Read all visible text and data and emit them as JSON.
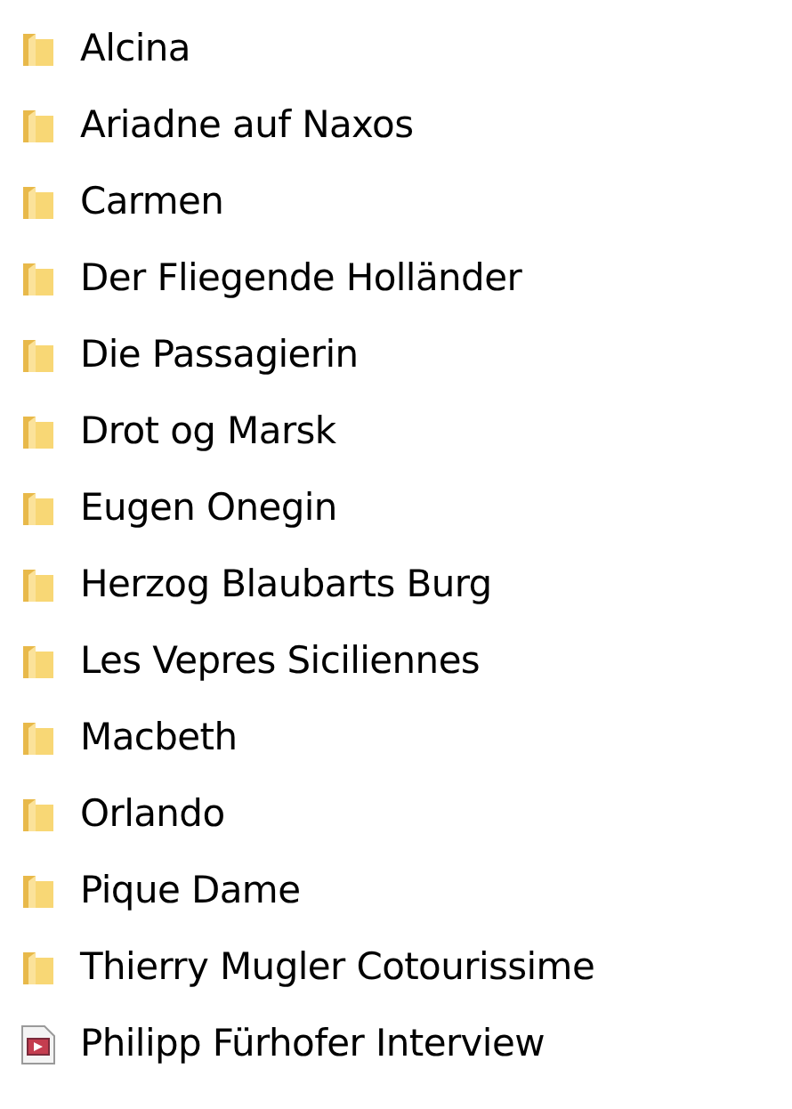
{
  "items": [
    {
      "kind": "folder",
      "name": "Alcina"
    },
    {
      "kind": "folder",
      "name": "Ariadne auf Naxos"
    },
    {
      "kind": "folder",
      "name": "Carmen"
    },
    {
      "kind": "folder",
      "name": "Der Fliegende Holländer"
    },
    {
      "kind": "folder",
      "name": "Die Passagierin"
    },
    {
      "kind": "folder",
      "name": "Drot og Marsk"
    },
    {
      "kind": "folder",
      "name": "Eugen Onegin"
    },
    {
      "kind": "folder",
      "name": "Herzog Blaubarts Burg"
    },
    {
      "kind": "folder",
      "name": "Les Vepres Siciliennes"
    },
    {
      "kind": "folder",
      "name": "Macbeth"
    },
    {
      "kind": "folder",
      "name": "Orlando"
    },
    {
      "kind": "folder",
      "name": "Pique Dame"
    },
    {
      "kind": "folder",
      "name": "Thierry Mugler Cotourissime"
    },
    {
      "kind": "video",
      "name": "Philipp Fürhofer Interview"
    }
  ]
}
